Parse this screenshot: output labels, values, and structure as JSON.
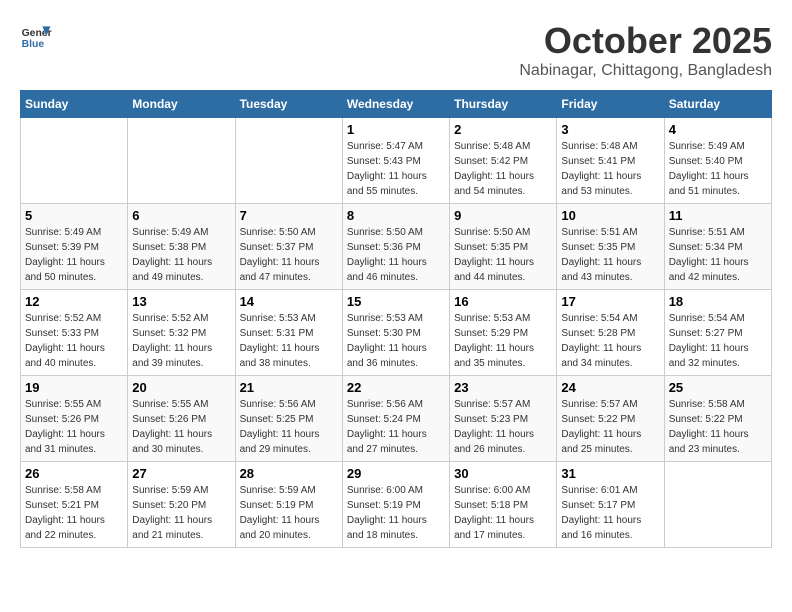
{
  "header": {
    "logo_line1": "General",
    "logo_line2": "Blue",
    "month": "October 2025",
    "location": "Nabinagar, Chittagong, Bangladesh"
  },
  "weekdays": [
    "Sunday",
    "Monday",
    "Tuesday",
    "Wednesday",
    "Thursday",
    "Friday",
    "Saturday"
  ],
  "weeks": [
    [
      {
        "day": "",
        "info": ""
      },
      {
        "day": "",
        "info": ""
      },
      {
        "day": "",
        "info": ""
      },
      {
        "day": "1",
        "info": "Sunrise: 5:47 AM\nSunset: 5:43 PM\nDaylight: 11 hours\nand 55 minutes."
      },
      {
        "day": "2",
        "info": "Sunrise: 5:48 AM\nSunset: 5:42 PM\nDaylight: 11 hours\nand 54 minutes."
      },
      {
        "day": "3",
        "info": "Sunrise: 5:48 AM\nSunset: 5:41 PM\nDaylight: 11 hours\nand 53 minutes."
      },
      {
        "day": "4",
        "info": "Sunrise: 5:49 AM\nSunset: 5:40 PM\nDaylight: 11 hours\nand 51 minutes."
      }
    ],
    [
      {
        "day": "5",
        "info": "Sunrise: 5:49 AM\nSunset: 5:39 PM\nDaylight: 11 hours\nand 50 minutes."
      },
      {
        "day": "6",
        "info": "Sunrise: 5:49 AM\nSunset: 5:38 PM\nDaylight: 11 hours\nand 49 minutes."
      },
      {
        "day": "7",
        "info": "Sunrise: 5:50 AM\nSunset: 5:37 PM\nDaylight: 11 hours\nand 47 minutes."
      },
      {
        "day": "8",
        "info": "Sunrise: 5:50 AM\nSunset: 5:36 PM\nDaylight: 11 hours\nand 46 minutes."
      },
      {
        "day": "9",
        "info": "Sunrise: 5:50 AM\nSunset: 5:35 PM\nDaylight: 11 hours\nand 44 minutes."
      },
      {
        "day": "10",
        "info": "Sunrise: 5:51 AM\nSunset: 5:35 PM\nDaylight: 11 hours\nand 43 minutes."
      },
      {
        "day": "11",
        "info": "Sunrise: 5:51 AM\nSunset: 5:34 PM\nDaylight: 11 hours\nand 42 minutes."
      }
    ],
    [
      {
        "day": "12",
        "info": "Sunrise: 5:52 AM\nSunset: 5:33 PM\nDaylight: 11 hours\nand 40 minutes."
      },
      {
        "day": "13",
        "info": "Sunrise: 5:52 AM\nSunset: 5:32 PM\nDaylight: 11 hours\nand 39 minutes."
      },
      {
        "day": "14",
        "info": "Sunrise: 5:53 AM\nSunset: 5:31 PM\nDaylight: 11 hours\nand 38 minutes."
      },
      {
        "day": "15",
        "info": "Sunrise: 5:53 AM\nSunset: 5:30 PM\nDaylight: 11 hours\nand 36 minutes."
      },
      {
        "day": "16",
        "info": "Sunrise: 5:53 AM\nSunset: 5:29 PM\nDaylight: 11 hours\nand 35 minutes."
      },
      {
        "day": "17",
        "info": "Sunrise: 5:54 AM\nSunset: 5:28 PM\nDaylight: 11 hours\nand 34 minutes."
      },
      {
        "day": "18",
        "info": "Sunrise: 5:54 AM\nSunset: 5:27 PM\nDaylight: 11 hours\nand 32 minutes."
      }
    ],
    [
      {
        "day": "19",
        "info": "Sunrise: 5:55 AM\nSunset: 5:26 PM\nDaylight: 11 hours\nand 31 minutes."
      },
      {
        "day": "20",
        "info": "Sunrise: 5:55 AM\nSunset: 5:26 PM\nDaylight: 11 hours\nand 30 minutes."
      },
      {
        "day": "21",
        "info": "Sunrise: 5:56 AM\nSunset: 5:25 PM\nDaylight: 11 hours\nand 29 minutes."
      },
      {
        "day": "22",
        "info": "Sunrise: 5:56 AM\nSunset: 5:24 PM\nDaylight: 11 hours\nand 27 minutes."
      },
      {
        "day": "23",
        "info": "Sunrise: 5:57 AM\nSunset: 5:23 PM\nDaylight: 11 hours\nand 26 minutes."
      },
      {
        "day": "24",
        "info": "Sunrise: 5:57 AM\nSunset: 5:22 PM\nDaylight: 11 hours\nand 25 minutes."
      },
      {
        "day": "25",
        "info": "Sunrise: 5:58 AM\nSunset: 5:22 PM\nDaylight: 11 hours\nand 23 minutes."
      }
    ],
    [
      {
        "day": "26",
        "info": "Sunrise: 5:58 AM\nSunset: 5:21 PM\nDaylight: 11 hours\nand 22 minutes."
      },
      {
        "day": "27",
        "info": "Sunrise: 5:59 AM\nSunset: 5:20 PM\nDaylight: 11 hours\nand 21 minutes."
      },
      {
        "day": "28",
        "info": "Sunrise: 5:59 AM\nSunset: 5:19 PM\nDaylight: 11 hours\nand 20 minutes."
      },
      {
        "day": "29",
        "info": "Sunrise: 6:00 AM\nSunset: 5:19 PM\nDaylight: 11 hours\nand 18 minutes."
      },
      {
        "day": "30",
        "info": "Sunrise: 6:00 AM\nSunset: 5:18 PM\nDaylight: 11 hours\nand 17 minutes."
      },
      {
        "day": "31",
        "info": "Sunrise: 6:01 AM\nSunset: 5:17 PM\nDaylight: 11 hours\nand 16 minutes."
      },
      {
        "day": "",
        "info": ""
      }
    ]
  ]
}
